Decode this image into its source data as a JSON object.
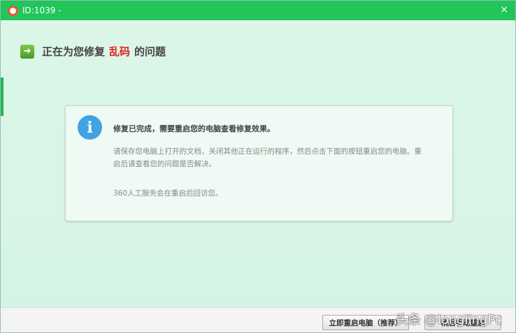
{
  "window": {
    "title": "ID:1039 -",
    "close": "×"
  },
  "header": {
    "prefix": "正在为您修复",
    "issue": "乱码",
    "suffix": "的问题"
  },
  "card": {
    "title": "修复已完成，需要重启您的电脑查看修复效果。",
    "body": "请保存您电脑上打开的文档，关闭其他正在运行的程序，然后点击下面的按钮重启您的电脑。重启后请查看您的问题是否解决。",
    "note": "360人工服务会在重启后回访您。",
    "icon": "i"
  },
  "buttons": {
    "restart": "立即重启电脑（推荐）",
    "later": "稍后手动重启"
  },
  "watermark": "头条 @longlingPc"
}
